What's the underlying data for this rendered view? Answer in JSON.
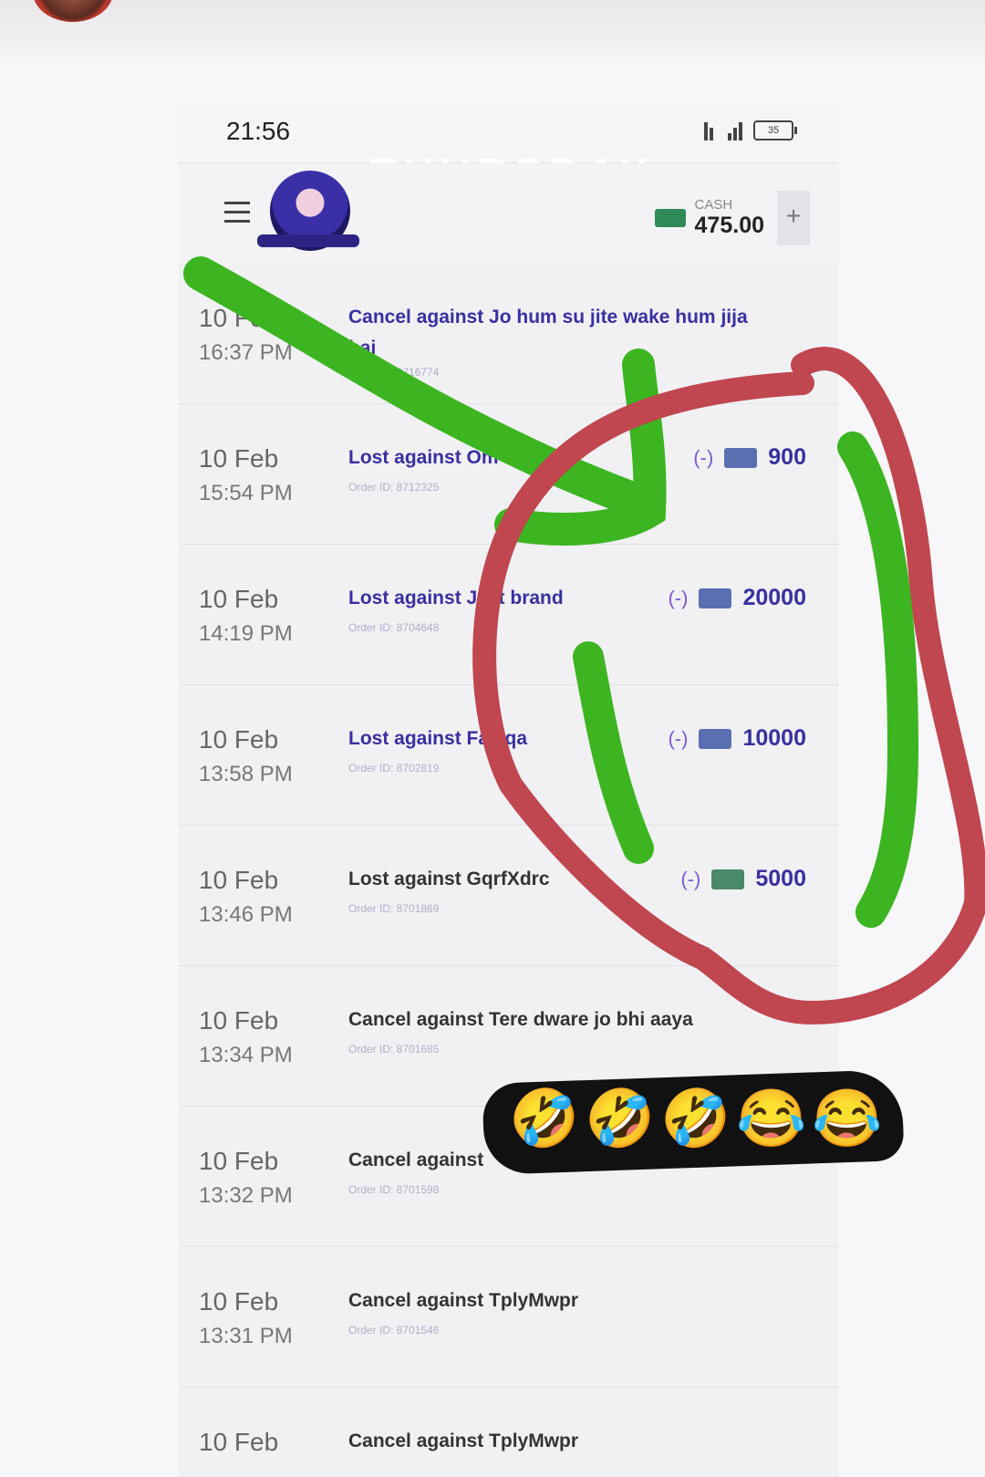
{
  "status": {
    "time": "21:56",
    "battery": "35"
  },
  "watermark": "THURSDAY",
  "header": {
    "cash_label": "CASH",
    "cash_value": "475.00",
    "add_label": "+"
  },
  "transactions": [
    {
      "date": "10 Feb",
      "time": "16:37 PM",
      "title": "Cancel against Jo hum su jite wake hum jija hai",
      "order": "Order ID: 8716774",
      "amount": ""
    },
    {
      "date": "10 Feb",
      "time": "15:54 PM",
      "title": "Lost against Om na",
      "order": "Order ID: 8712325",
      "sign": "(-)",
      "amount": "900"
    },
    {
      "date": "10 Feb",
      "time": "14:19 PM",
      "title": "Lost against Jeet brand",
      "order": "Order ID: 8704648",
      "sign": "(-)",
      "amount": "20000"
    },
    {
      "date": "10 Feb",
      "time": "13:58 PM",
      "title": "Lost against Fayiqa",
      "order": "Order ID: 8702819",
      "sign": "(-)",
      "amount": "10000"
    },
    {
      "date": "10 Feb",
      "time": "13:46 PM",
      "title": "Lost against GqrfXdrc",
      "order": "Order ID: 8701869",
      "sign": "(-)",
      "amount": "5000"
    },
    {
      "date": "10 Feb",
      "time": "13:34 PM",
      "title": "Cancel against Tere dware jo bhi aaya",
      "order": "Order ID: 8701685",
      "amount": ""
    },
    {
      "date": "10 Feb",
      "time": "13:32 PM",
      "title": "Cancel against",
      "order": "Order ID: 8701598",
      "amount": ""
    },
    {
      "date": "10 Feb",
      "time": "13:31 PM",
      "title": "Cancel against TplyMwpr",
      "order": "Order ID: 8701546",
      "amount": ""
    },
    {
      "date": "10 Feb",
      "time": "",
      "title": "Cancel against TplyMwpr",
      "order": "",
      "amount": ""
    }
  ],
  "sticker": {
    "emojis": [
      "🤣",
      "🤣",
      "🤣",
      "😂",
      "😂"
    ]
  },
  "colors": {
    "accent": "#3a2fa0",
    "green_mark": "#3cb521",
    "red_mark": "#c0464f"
  }
}
